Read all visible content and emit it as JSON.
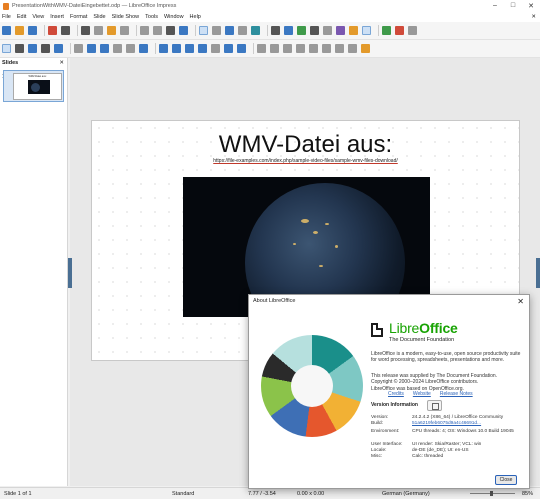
{
  "window": {
    "title": "PresentationWithWMV-DateiEingebettet.odp — LibreOffice Impress"
  },
  "menu": [
    "File",
    "Edit",
    "View",
    "Insert",
    "Format",
    "Slide",
    "Slide Show",
    "Tools",
    "Window",
    "Help"
  ],
  "slides_panel": {
    "title": "Slides",
    "slide_number": "1"
  },
  "slide": {
    "title": "WMV-Datei aus:",
    "url": "https://file-examples.com/index.php/sample-video-files/sample-wmv-files-download/"
  },
  "status": {
    "slide": "Slide 1 of 1",
    "layout": "Standard",
    "position": "7.77 / -3.54",
    "size": "0.00 x 0.00",
    "language": "German (Germany)",
    "zoom": "85%"
  },
  "about": {
    "title": "About LibreOffice",
    "brand_light": "Libre",
    "brand_bold": "Office",
    "subtitle": "The Document Foundation",
    "description": "LibreOffice is a modern, easy-to-use, open source productivity suite for word processing, spreadsheets, presentations and more.",
    "supplied": "This release was supplied by The Document Foundation.",
    "copyright": "Copyright © 2000–2024 LibreOffice contributors.",
    "based": "LibreOffice was based on OpenOffice.org.",
    "links": [
      "Credits",
      "Website",
      "Release Notes"
    ],
    "version_info_title": "Version Information",
    "rows": [
      {
        "k": "Version:",
        "v": "24.2.4.2 (X86_64) / LibreOffice Community"
      },
      {
        "k": "Build:",
        "v": "51a6219feb6075d9a4c46691d..."
      },
      {
        "k": "Environment:",
        "v": "CPU threads: 4; OS: Windows 10.0 Build 19045"
      },
      {
        "k": "User Interface:",
        "v": "UI render: Skia/Raster; VCL: win"
      },
      {
        "k": "Locale:",
        "v": "de-DE (de_DE); UI: en-US"
      },
      {
        "k": "Misc:",
        "v": "Calc: threaded"
      }
    ],
    "close_label": "Close"
  }
}
